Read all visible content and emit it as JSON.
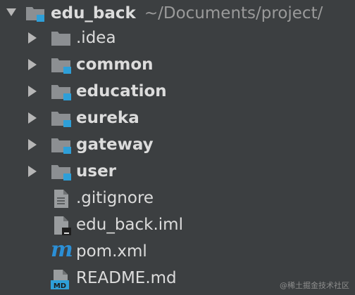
{
  "tree": {
    "root": {
      "name": "edu_back",
      "path": "~/Documents/project/"
    },
    "folders": [
      {
        "name": ".idea",
        "module": false
      },
      {
        "name": "common",
        "module": true
      },
      {
        "name": "education",
        "module": true
      },
      {
        "name": "eureka",
        "module": true
      },
      {
        "name": "gateway",
        "module": true
      },
      {
        "name": "user",
        "module": true
      }
    ],
    "files": [
      {
        "name": ".gitignore",
        "icon": "text-file-icon"
      },
      {
        "name": "edu_back.iml",
        "icon": "module-file-icon"
      },
      {
        "name": "pom.xml",
        "icon": "maven-icon"
      },
      {
        "name": "README.md",
        "icon": "markdown-icon",
        "badge": "MD"
      }
    ]
  },
  "watermark": "@稀土掘金技术社区",
  "colors": {
    "background": "#3c3f41",
    "folder": "#8c8f92",
    "module_badge": "#2e9fd8",
    "maven": "#2b8fd6"
  }
}
